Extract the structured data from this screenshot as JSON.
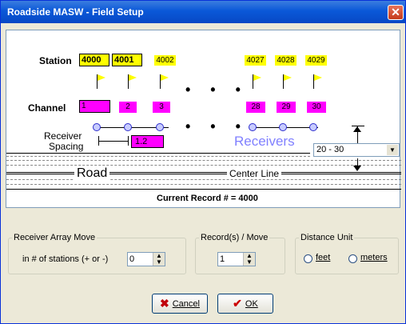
{
  "window": {
    "title": "Roadside MASW - Field Setup",
    "close_glyph": "✕"
  },
  "diagram": {
    "station_label": "Station",
    "station_inputs": [
      "4000",
      "4001"
    ],
    "station_labels": [
      "4002",
      "4027",
      "4028",
      "4029"
    ],
    "channel_label": "Channel",
    "channel_input": "1",
    "channel_labels": [
      "2",
      "3",
      "28",
      "29",
      "30"
    ],
    "ellipsis": "• • •",
    "receiver_spacing_label_1": "Receiver",
    "receiver_spacing_label_2": "Spacing",
    "spacing_value": "1.2",
    "receivers_label": "Receivers",
    "offset_select": "20 - 30",
    "road_label": "Road",
    "center_line_label": "Center Line",
    "current_record": "Current Record # = 4000"
  },
  "receiver_array": {
    "group_label": "Receiver Array Move",
    "label": "in # of stations (+ or -)",
    "value": "0"
  },
  "records_move": {
    "group_label": "Record(s) / Move",
    "value": "1"
  },
  "distance_unit": {
    "group_label": "Distance Unit",
    "options": [
      "feet",
      "meters"
    ]
  },
  "buttons": {
    "cancel": "Cancel",
    "ok": "OK"
  },
  "colors": {
    "station": "#ffff00",
    "channel": "#ff00ff",
    "receivers_text": "#8080ff"
  }
}
